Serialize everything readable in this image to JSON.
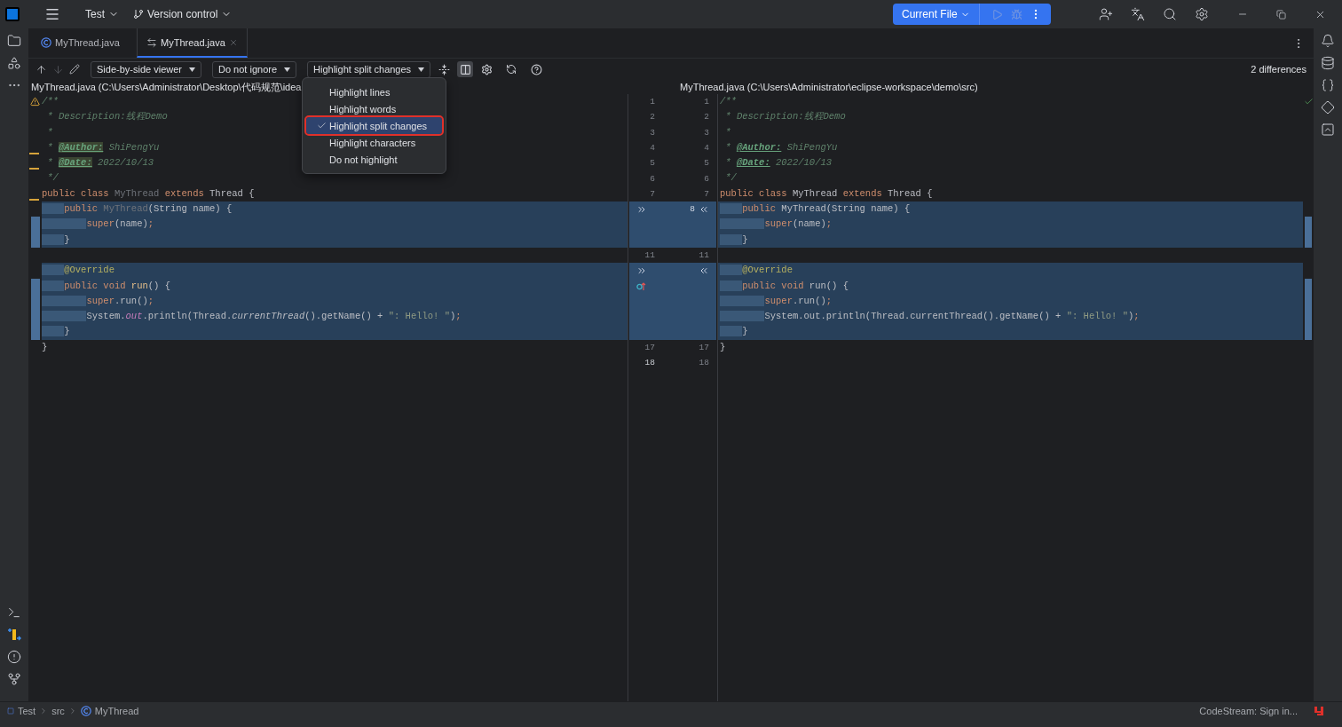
{
  "title_bar": {
    "project": "Test",
    "vcs": "Version control",
    "run_config": "Current File"
  },
  "tabs": [
    {
      "label": "MyThread.java",
      "kind": "class",
      "selected": false
    },
    {
      "label": "MyThread.java",
      "kind": "diff",
      "selected": true
    }
  ],
  "diff_toolbar": {
    "viewer": "Side-by-side viewer",
    "ignore": "Do not ignore",
    "highlight": "Highlight split changes",
    "split_view_on": true,
    "differences": "2 differences"
  },
  "highlight_menu": [
    {
      "label": "Highlight lines",
      "selected": false
    },
    {
      "label": "Highlight words",
      "selected": false
    },
    {
      "label": "Highlight split changes",
      "selected": true
    },
    {
      "label": "Highlight characters",
      "selected": false
    },
    {
      "label": "Do not highlight",
      "selected": false
    }
  ],
  "left_file": {
    "path": "MyThread.java (C:\\Users\\Administrator\\Desktop\\代码规范\\idea"
  },
  "right_file": {
    "path": "MyThread.java (C:\\Users\\Administrator\\eclipse-workspace\\demo\\src)"
  },
  "lines": [
    {
      "left_number": "1",
      "right_number": "1",
      "changed": false,
      "mark": {
        "kind": "warning"
      },
      "left": [
        {
          "text": "/**",
          "kind": "comment"
        }
      ],
      "right": [
        {
          "text": "/**",
          "kind": "comment"
        }
      ]
    },
    {
      "left_number": "2",
      "right_number": "2",
      "changed": false,
      "left": [
        {
          "text": " * Description:线程Demo",
          "kind": "comment"
        }
      ],
      "right": [
        {
          "text": " * Description:线程Demo",
          "kind": "comment"
        }
      ]
    },
    {
      "left_number": "3",
      "right_number": "3",
      "changed": false,
      "left": [
        {
          "text": " *",
          "kind": "comment"
        }
      ],
      "right": [
        {
          "text": " *",
          "kind": "comment"
        }
      ]
    },
    {
      "left_number": "4",
      "right_number": "4",
      "changed": false,
      "mark": {
        "kind": "underline"
      },
      "left": [
        {
          "text": " * ",
          "kind": "comment"
        },
        {
          "text": "@Author:",
          "kind": "tag-marked"
        },
        {
          "text": " ShiPengYu",
          "kind": "comment"
        }
      ],
      "right": [
        {
          "text": " * ",
          "kind": "comment"
        },
        {
          "text": "@Author:",
          "kind": "tag"
        },
        {
          "text": " ShiPengYu",
          "kind": "comment"
        }
      ]
    },
    {
      "left_number": "5",
      "right_number": "5",
      "changed": false,
      "mark": {
        "kind": "underline"
      },
      "left": [
        {
          "text": " * ",
          "kind": "comment"
        },
        {
          "text": "@Date:",
          "kind": "tag-marked"
        },
        {
          "text": " 2022/10/13",
          "kind": "comment"
        }
      ],
      "right": [
        {
          "text": " * ",
          "kind": "comment"
        },
        {
          "text": "@Date:",
          "kind": "tag"
        },
        {
          "text": " 2022/10/13",
          "kind": "comment"
        }
      ]
    },
    {
      "left_number": "6",
      "right_number": "6",
      "changed": false,
      "left": [
        {
          "text": " */",
          "kind": "comment"
        }
      ],
      "right": [
        {
          "text": " */",
          "kind": "comment"
        }
      ]
    },
    {
      "left_number": "7",
      "right_number": "7",
      "changed": false,
      "mark": {
        "kind": "underline"
      },
      "left": [
        {
          "text": "public class ",
          "kind": "kw"
        },
        {
          "text": "MyThread",
          "kind": "dim"
        },
        {
          "text": " extends ",
          "kind": "kw"
        },
        {
          "text": "Thread {",
          "kind": "plain"
        }
      ],
      "right": [
        {
          "text": "public class ",
          "kind": "kw"
        },
        {
          "text": "MyThread",
          "kind": "plain"
        },
        {
          "text": " extends ",
          "kind": "kw"
        },
        {
          "text": "Thread {",
          "kind": "plain"
        }
      ]
    },
    {
      "right_number": "8",
      "changed": true,
      "apply_left": true,
      "apply_right": true,
      "indent": {
        "kind": "single"
      },
      "left": [
        {
          "text": "public ",
          "kind": "kw"
        },
        {
          "text": "MyThread",
          "kind": "dim"
        },
        {
          "text": "(String name) {",
          "kind": "plain"
        }
      ],
      "right": [
        {
          "text": "public ",
          "kind": "kw"
        },
        {
          "text": "MyThread",
          "kind": "plain"
        },
        {
          "text": "(String name) {",
          "kind": "plain"
        }
      ]
    },
    {
      "changed": true,
      "mark": {
        "kind": "bar"
      },
      "indent": {
        "kind": "double"
      },
      "left": [
        {
          "text": "super",
          "kind": "kw"
        },
        {
          "text": "(name)",
          "kind": "plain"
        },
        {
          "text": ";",
          "kind": "kw"
        }
      ],
      "right": [
        {
          "text": "super",
          "kind": "kw"
        },
        {
          "text": "(name)",
          "kind": "plain"
        },
        {
          "text": ";",
          "kind": "kw"
        }
      ]
    },
    {
      "changed": true,
      "mark": {
        "kind": "bar"
      },
      "indent": {
        "kind": "single"
      },
      "left": [
        {
          "text": "}",
          "kind": "plain"
        }
      ],
      "right": [
        {
          "text": "}",
          "kind": "plain"
        }
      ]
    },
    {
      "left_number": "11",
      "right_number": "11",
      "changed": false
    },
    {
      "changed": true,
      "apply_left": true,
      "apply_right": true,
      "indent": {
        "kind": "single"
      },
      "left": [
        {
          "text": "@Override",
          "kind": "annotation"
        }
      ],
      "right": [
        {
          "text": "@Override",
          "kind": "annotation"
        }
      ]
    },
    {
      "changed": true,
      "override_mark": true,
      "mark": {
        "kind": "bar"
      },
      "indent": {
        "kind": "single"
      },
      "left": [
        {
          "text": "public void ",
          "kind": "kw"
        },
        {
          "text": "run",
          "kind": "method"
        },
        {
          "text": "() {",
          "kind": "plain"
        }
      ],
      "right": [
        {
          "text": "public void ",
          "kind": "kw"
        },
        {
          "text": "run",
          "kind": "plain"
        },
        {
          "text": "() {",
          "kind": "plain"
        }
      ]
    },
    {
      "changed": true,
      "mark": {
        "kind": "bar"
      },
      "indent": {
        "kind": "double"
      },
      "left": [
        {
          "text": "super",
          "kind": "kw"
        },
        {
          "text": ".run()",
          "kind": "plain"
        },
        {
          "text": ";",
          "kind": "kw"
        }
      ],
      "right": [
        {
          "text": "super",
          "kind": "kw"
        },
        {
          "text": ".run()",
          "kind": "plain"
        },
        {
          "text": ";",
          "kind": "kw"
        }
      ]
    },
    {
      "changed": true,
      "mark": {
        "kind": "bar"
      },
      "indent": {
        "kind": "double"
      },
      "left": [
        {
          "text": "System.",
          "kind": "plain"
        },
        {
          "text": "out",
          "kind": "field"
        },
        {
          "text": ".println(Thread.",
          "kind": "plain"
        },
        {
          "text": "currentThread",
          "kind": "italic"
        },
        {
          "text": "().getName() + ",
          "kind": "plain"
        },
        {
          "text": "\": Hello! \"",
          "kind": "string"
        },
        {
          "text": ")",
          "kind": "plain"
        },
        {
          "text": ";",
          "kind": "kw"
        }
      ],
      "right": [
        {
          "text": "System.out.println(Thread.currentThread().getName() + ",
          "kind": "plain"
        },
        {
          "text": "\": Hello! \"",
          "kind": "string"
        },
        {
          "text": ")",
          "kind": "plain"
        },
        {
          "text": ";",
          "kind": "kw"
        }
      ]
    },
    {
      "changed": true,
      "mark": {
        "kind": "bar"
      },
      "indent": {
        "kind": "single"
      },
      "left": [
        {
          "text": "}",
          "kind": "plain"
        }
      ],
      "right": [
        {
          "text": "}",
          "kind": "plain"
        }
      ]
    },
    {
      "left_number": "17",
      "right_number": "17",
      "changed": false,
      "left": [
        {
          "text": "}",
          "kind": "plain"
        }
      ],
      "right": [
        {
          "text": "}",
          "kind": "plain"
        }
      ]
    },
    {
      "left_number": "18",
      "right_number": "18",
      "changed": false,
      "current": true
    }
  ],
  "status_bar": {
    "breadcrumbs": [
      {
        "label": "Test",
        "kind": "module"
      },
      {
        "label": "src",
        "kind": "folder"
      },
      {
        "label": "MyThread",
        "kind": "class"
      }
    ],
    "codestream": "CodeStream: Sign in..."
  }
}
